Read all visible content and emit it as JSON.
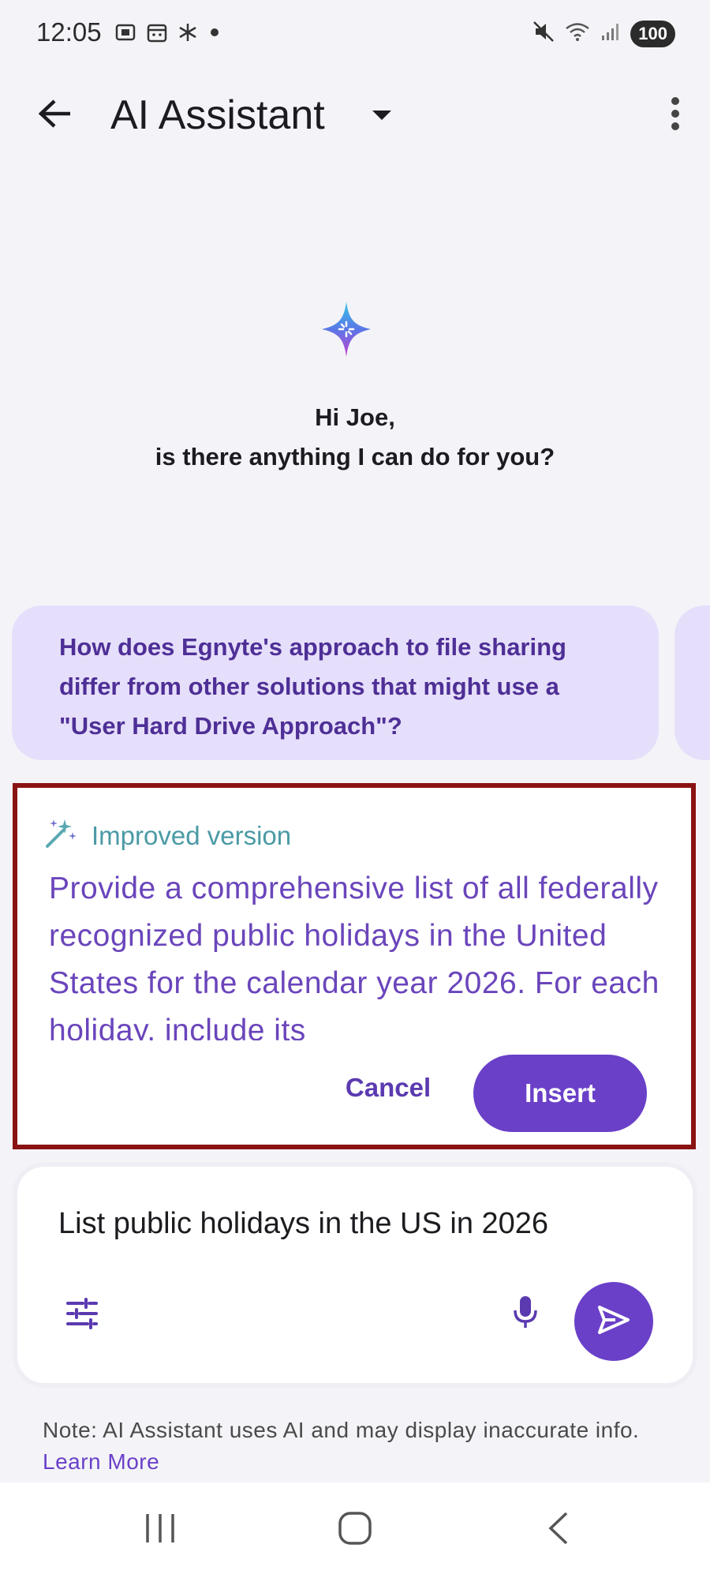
{
  "status_bar": {
    "time": "12:05",
    "battery": "100",
    "left_icons": [
      "screenshot-icon",
      "calendar-icon",
      "asterisk-icon",
      "dot-icon"
    ],
    "right_icons": [
      "mute-icon",
      "wifi-icon",
      "signal-icon"
    ]
  },
  "app_bar": {
    "title": "AI Assistant",
    "icons": [
      "back-arrow-icon",
      "dropdown-icon",
      "more-vertical-icon"
    ]
  },
  "greeting": {
    "line1": "Hi Joe,",
    "line2": "is there anything I can do for you?"
  },
  "suggestion": {
    "text": "How does Egnyte's approach to file sharing differ from other solutions that might use a \"User Hard Drive Approach\"?"
  },
  "improved": {
    "label": "Improved version",
    "text": "Provide a comprehensive list of all federally recognized public holidays in the United States for the calendar year 2026. For each holiday, include its",
    "cancel_label": "Cancel",
    "insert_label": "Insert"
  },
  "composer": {
    "value": "List public holidays in the US in 2026"
  },
  "note": {
    "text": "Note: AI Assistant uses AI and may display inaccurate info.",
    "link": "Learn More"
  },
  "colors": {
    "accent": "#6a40c8",
    "suggestion_bg": "#e6dffb",
    "highlight_border": "#8a1212",
    "improved_label": "#4a9aa5"
  }
}
